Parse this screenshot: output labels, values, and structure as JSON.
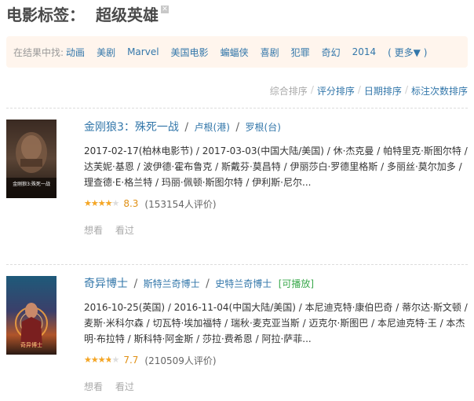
{
  "header": {
    "prefix": "电影标签：",
    "tag": "超级英雄",
    "remove_icon": "close-icon"
  },
  "filter": {
    "label": "在结果中找:",
    "items": [
      "动画",
      "美剧",
      "Marvel",
      "美国电影",
      "蝙蝠侠",
      "喜剧",
      "犯罪",
      "奇幻",
      "2014"
    ],
    "more": "( 更多▼ )"
  },
  "sort": {
    "items": [
      "综合排序",
      "评分排序",
      "日期排序",
      "标注次数排序"
    ],
    "separator": "/"
  },
  "movies": [
    {
      "title": "金刚狼3：殊死一战",
      "alt_titles": [
        "卢根(港)",
        "罗根(台)"
      ],
      "playable": "",
      "desc": "2017-02-17(柏林电影节) / 2017-03-03(中国大陆/美国) / 休·杰克曼 / 帕特里克·斯图尔特 / 达芙妮·基恩 / 波伊德·霍布鲁克 / 斯戴芬·莫昌特 / 伊丽莎白·罗德里格斯 / 多丽丝·莫尔加多 / 理查德·E·格兰特 / 玛丽·佩顿·斯图尔特 / 伊利斯·尼尔...",
      "score": "8.3",
      "star_fraction": 0.83,
      "count": "(153154人评价)",
      "actions": [
        "想看",
        "看过"
      ],
      "poster_text": "金刚狼3:殊死一战"
    },
    {
      "title": "奇异博士",
      "alt_titles": [
        "斯特兰奇博士",
        "史特兰奇博士"
      ],
      "playable": "[可播放]",
      "desc": "2016-10-25(英国) / 2016-11-04(中国大陆/美国) / 本尼迪克特·康伯巴奇 / 蒂尔达·斯文顿 / 麦斯·米科尔森 / 切瓦特·埃加福特 / 瑞秋·麦克亚当斯 / 迈克尔·斯图巴 / 本尼迪克特·王 / 本杰明·布拉特 / 斯科特·阿金斯 / 莎拉·费希恩 / 阿拉·萨菲...",
      "score": "7.7",
      "star_fraction": 0.77,
      "count": "(210509人评价)",
      "actions": [
        "想看",
        "看过"
      ],
      "poster_text": "奇异博士"
    }
  ],
  "colors": {
    "link": "#3377aa",
    "filter_bg": "#fff5ed",
    "star": "#f6a623",
    "playable": "#3ba94d"
  }
}
